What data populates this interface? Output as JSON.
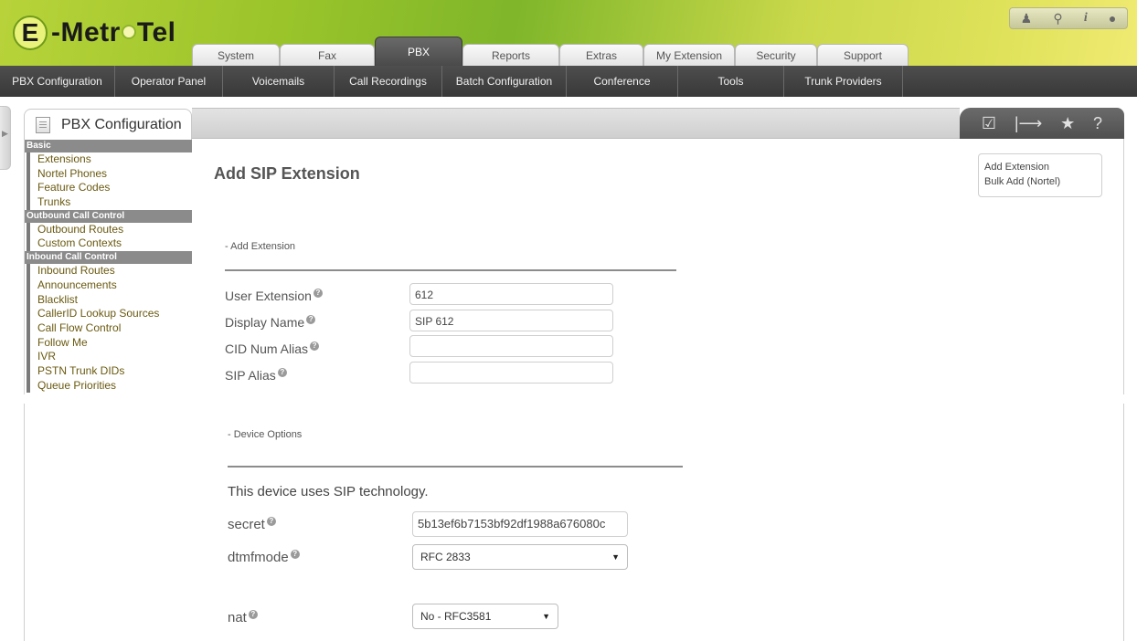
{
  "logo": {
    "letter": "E",
    "text_before": "-Metr",
    "text_after": "Tel"
  },
  "top_tabs": [
    "System",
    "Fax",
    "PBX",
    "Reports",
    "Extras",
    "My Extension",
    "Security",
    "Support"
  ],
  "active_tab": "PBX",
  "header_tools": {
    "icons": [
      "user-icon",
      "search-icon",
      "info-icon",
      "drop-icon"
    ],
    "info_glyph": "i"
  },
  "menu": [
    "PBX Configuration",
    "Operator Panel",
    "Voicemails",
    "Call Recordings",
    "Batch Configuration",
    "Conference",
    "Tools",
    "Trunk Providers"
  ],
  "side_tab_label": "PBX Configuration",
  "toolbar_icons": [
    "edit-icon",
    "export-icon",
    "star-icon",
    "help-icon"
  ],
  "toolbar_glyphs": {
    "edit": "☑",
    "export": "|⟶",
    "star": "★",
    "help": "?"
  },
  "sidebar": [
    {
      "heading": "Basic",
      "items": [
        "Extensions",
        "Nortel Phones",
        "Feature Codes",
        "Trunks"
      ]
    },
    {
      "heading": "Outbound Call Control",
      "items": [
        "Outbound Routes",
        "Custom Contexts"
      ]
    },
    {
      "heading": "Inbound Call Control",
      "items": [
        "Inbound Routes",
        "Announcements",
        "Blacklist",
        "CallerID Lookup Sources",
        "Call Flow Control",
        "Follow Me",
        "IVR",
        "PSTN Trunk DIDs",
        "Queue Priorities"
      ]
    }
  ],
  "page": {
    "title": "Add SIP Extension",
    "section_add": "- Add Extension",
    "fields": [
      {
        "label": "User Extension",
        "value": "612"
      },
      {
        "label": "Display Name",
        "value": "SIP 612"
      },
      {
        "label": "CID Num Alias",
        "value": ""
      },
      {
        "label": "SIP Alias",
        "value": ""
      }
    ],
    "add_links": [
      "Add Extension",
      "Bulk Add (Nortel)"
    ]
  },
  "device": {
    "section": "- Device Options",
    "note": "This device uses SIP technology.",
    "secret_label": "secret",
    "secret_value": "5b13ef6b7153bf92df1988a676080c",
    "dtmfmode_label": "dtmfmode",
    "dtmfmode_value": "RFC 2833",
    "nat_label": "nat",
    "nat_value": "No - RFC3581"
  },
  "help_glyph": "?"
}
